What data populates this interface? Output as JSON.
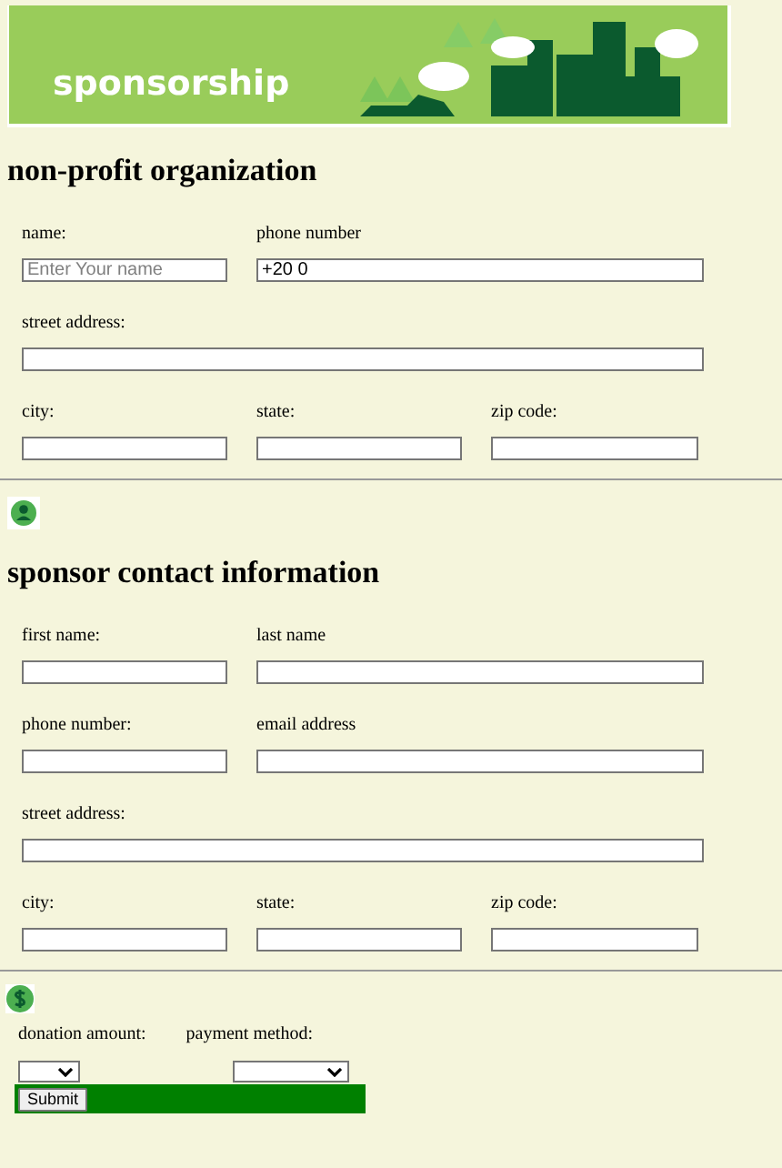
{
  "banner": {
    "title": "sponsorship"
  },
  "organization": {
    "title": "non-profit organization",
    "rows": [
      [
        {
          "label": "name:",
          "kind": "short",
          "placeholder": "Enter Your name"
        },
        {
          "label": "phone number",
          "kind": "long",
          "value": "+20 0"
        }
      ],
      [
        {
          "label": "street address:",
          "kind": "full"
        }
      ],
      [
        {
          "label": "city:",
          "kind": "short"
        },
        {
          "label": "state:",
          "kind": "short"
        },
        {
          "label": "zip code:",
          "kind": "short"
        }
      ]
    ]
  },
  "sponsor": {
    "title": "sponsor contact information",
    "rows": [
      [
        {
          "label": "first name:",
          "kind": "short"
        },
        {
          "label": "last name",
          "kind": "long"
        }
      ],
      [
        {
          "label": "phone number:",
          "kind": "short"
        },
        {
          "label": "email address",
          "kind": "long"
        }
      ],
      [
        {
          "label": "street address:",
          "kind": "full"
        }
      ],
      [
        {
          "label": "city:",
          "kind": "short"
        },
        {
          "label": "state:",
          "kind": "short"
        },
        {
          "label": "zip code:",
          "kind": "short"
        }
      ]
    ]
  },
  "donation": {
    "fields": [
      {
        "label": "donation amount:",
        "kind": "narrow"
      },
      {
        "label": "payment method:",
        "kind": "wide"
      }
    ],
    "submit": "Submit"
  }
}
